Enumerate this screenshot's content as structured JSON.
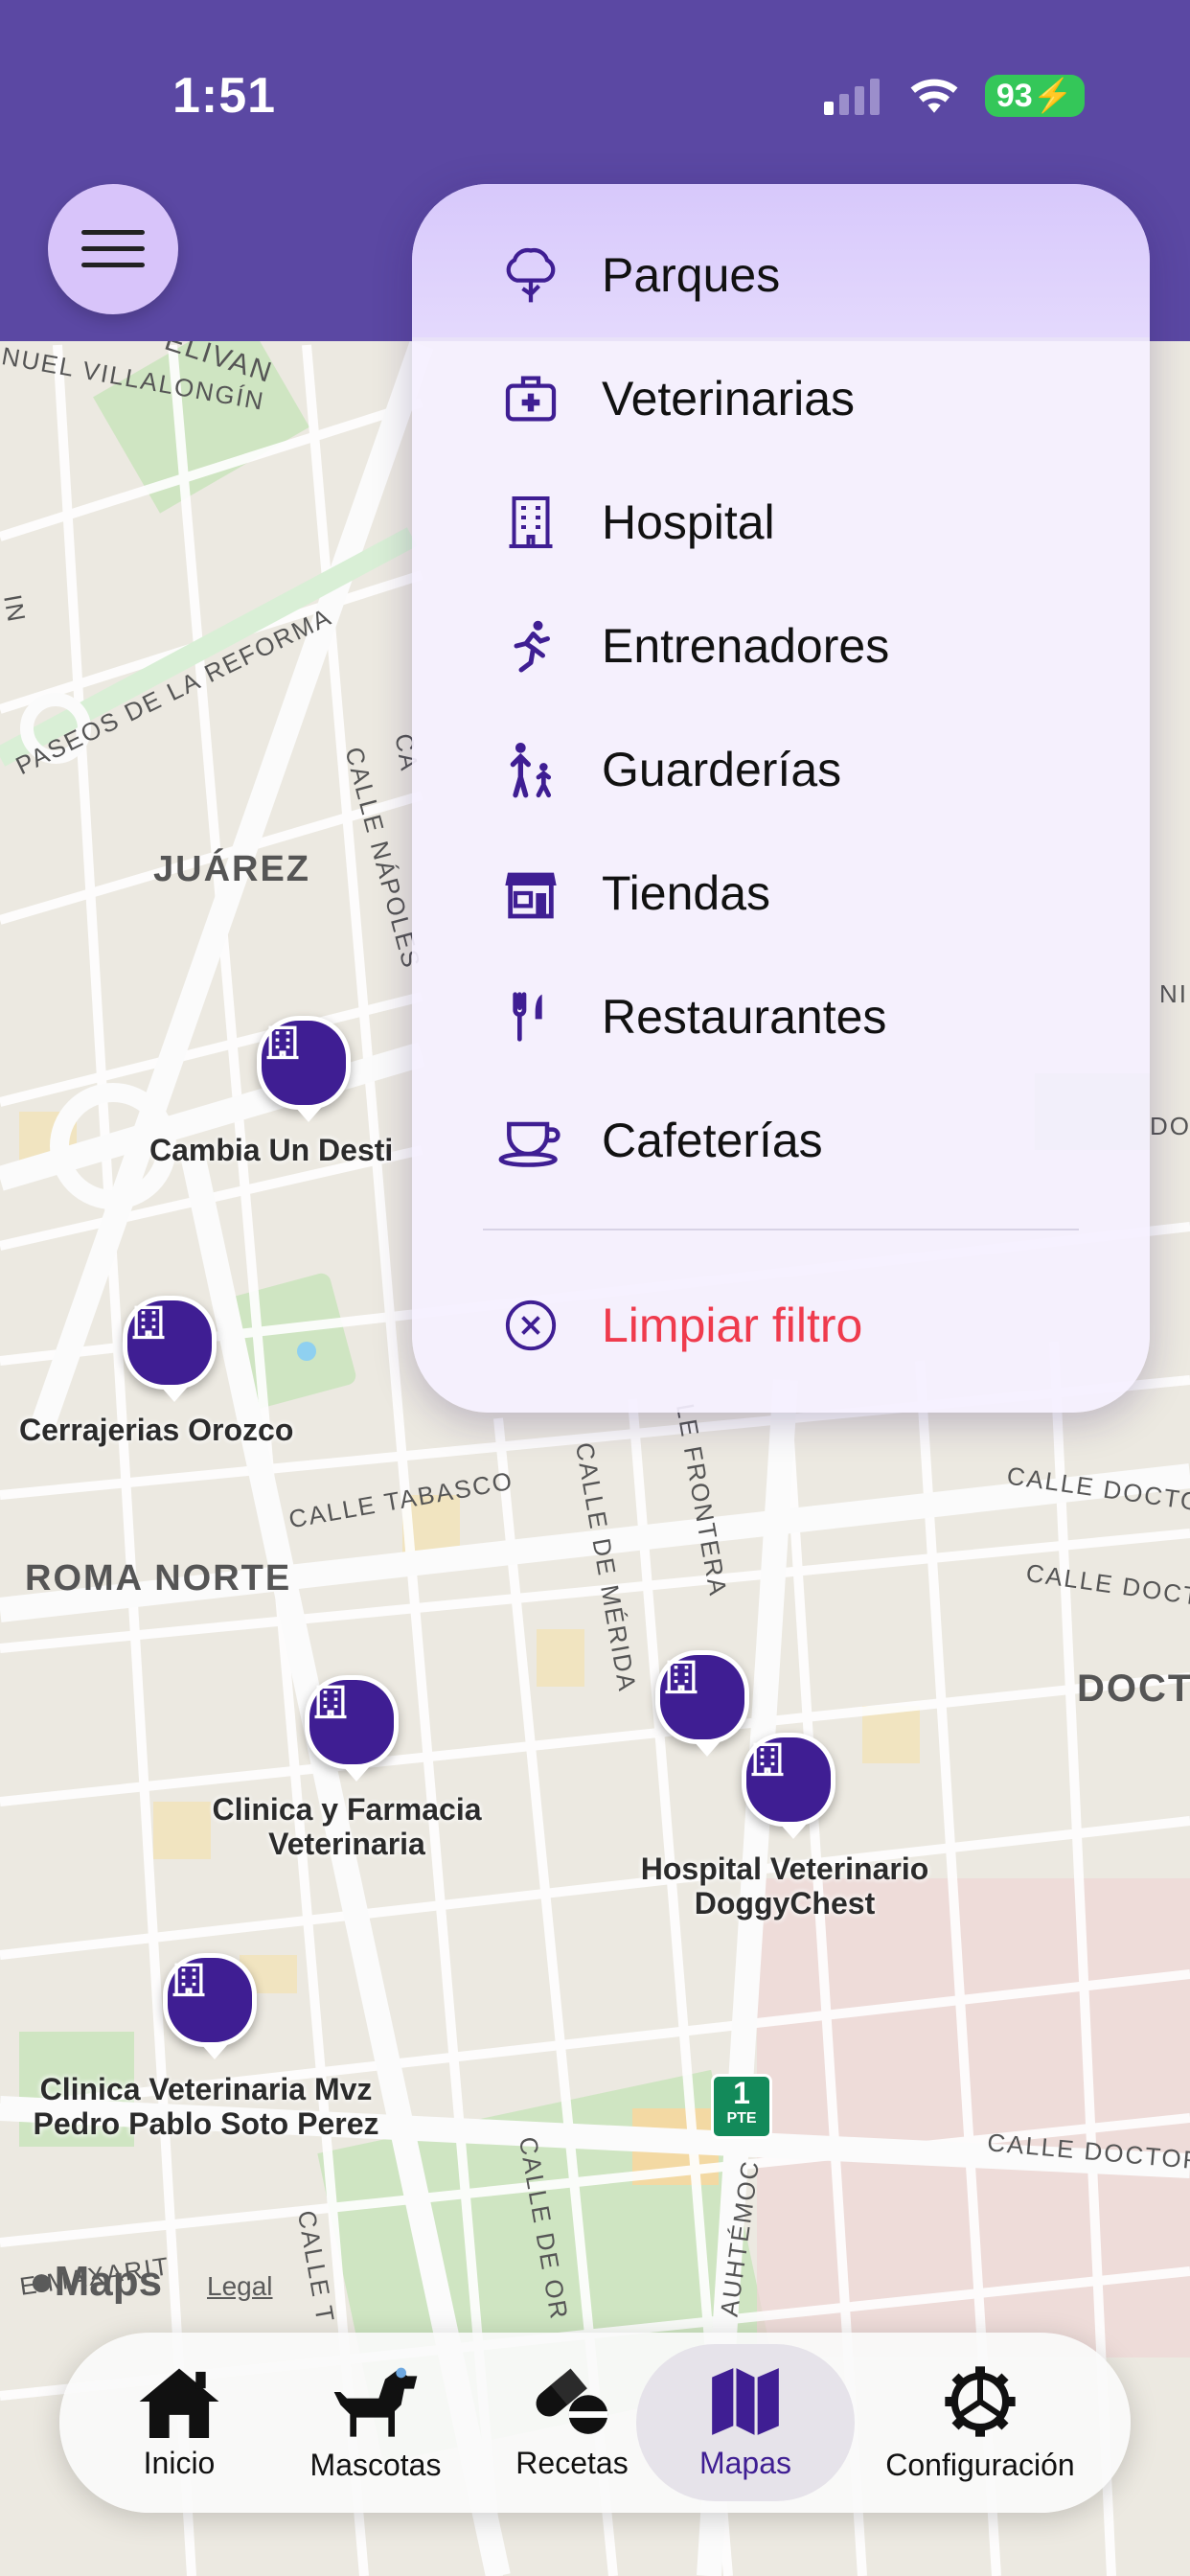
{
  "status": {
    "time": "1:51",
    "battery": "93"
  },
  "header": {
    "menu_icon": "hamburger-menu-icon"
  },
  "dropdown": {
    "items": [
      {
        "label": "Parques",
        "icon": "tree-icon",
        "selected": true
      },
      {
        "label": "Veterinarias",
        "icon": "medical-kit-icon"
      },
      {
        "label": "Hospital",
        "icon": "building-icon"
      },
      {
        "label": "Entrenadores",
        "icon": "running-person-icon"
      },
      {
        "label": "Guarderías",
        "icon": "adult-child-icon"
      },
      {
        "label": "Tiendas",
        "icon": "storefront-icon"
      },
      {
        "label": "Restaurantes",
        "icon": "fork-knife-icon"
      },
      {
        "label": "Cafeterías",
        "icon": "coffee-cup-icon"
      }
    ],
    "clear_label": "Limpiar filtro",
    "clear_icon": "x-circle-icon"
  },
  "map": {
    "districts": [
      "JUÁREZ",
      "ROMA NORTE",
      "DOCT"
    ],
    "streets": [
      "ELIVAN",
      "NUEL VILLALONGÍN",
      "PASEOS DE LA REFORMA",
      "CALLE NÁPOLES",
      "CALLE TABASCO",
      "CALLE DE MÉRIDA",
      "LE FRONTERA",
      "CALLE DOCTOR",
      "CALLE DOCTO",
      "CALLE DOCTOR",
      "AUHTÉMOC",
      "CALLE DE OR",
      "E MAXARIT",
      "CALLE T",
      "IN",
      "CA",
      "NID",
      "DOC"
    ],
    "places": [
      {
        "name": "Cambia Un Desti"
      },
      {
        "name": "Cerrajerias Orozco"
      },
      {
        "name": "Clinica y Farmacia Veterinaria"
      },
      {
        "name": "Hospital Veterinario DoggyChest"
      },
      {
        "name": "Clinica Veterinaria Mvz Pedro Pablo Soto Perez"
      }
    ],
    "route_shield": {
      "top": "1",
      "bottom": "PTE"
    },
    "attribution": "Maps",
    "legal": "Legal"
  },
  "tabbar": {
    "tabs": [
      {
        "label": "Inicio",
        "icon": "house-icon"
      },
      {
        "label": "Mascotas",
        "icon": "dog-icon"
      },
      {
        "label": "Recetas",
        "icon": "pills-icon"
      },
      {
        "label": "Mapas",
        "icon": "map-icon",
        "active": true
      },
      {
        "label": "Configuración",
        "icon": "gear-icon"
      }
    ]
  },
  "colors": {
    "brand": "#5b48a3",
    "accent": "#3f1e93",
    "danger": "#ef3b4d"
  }
}
